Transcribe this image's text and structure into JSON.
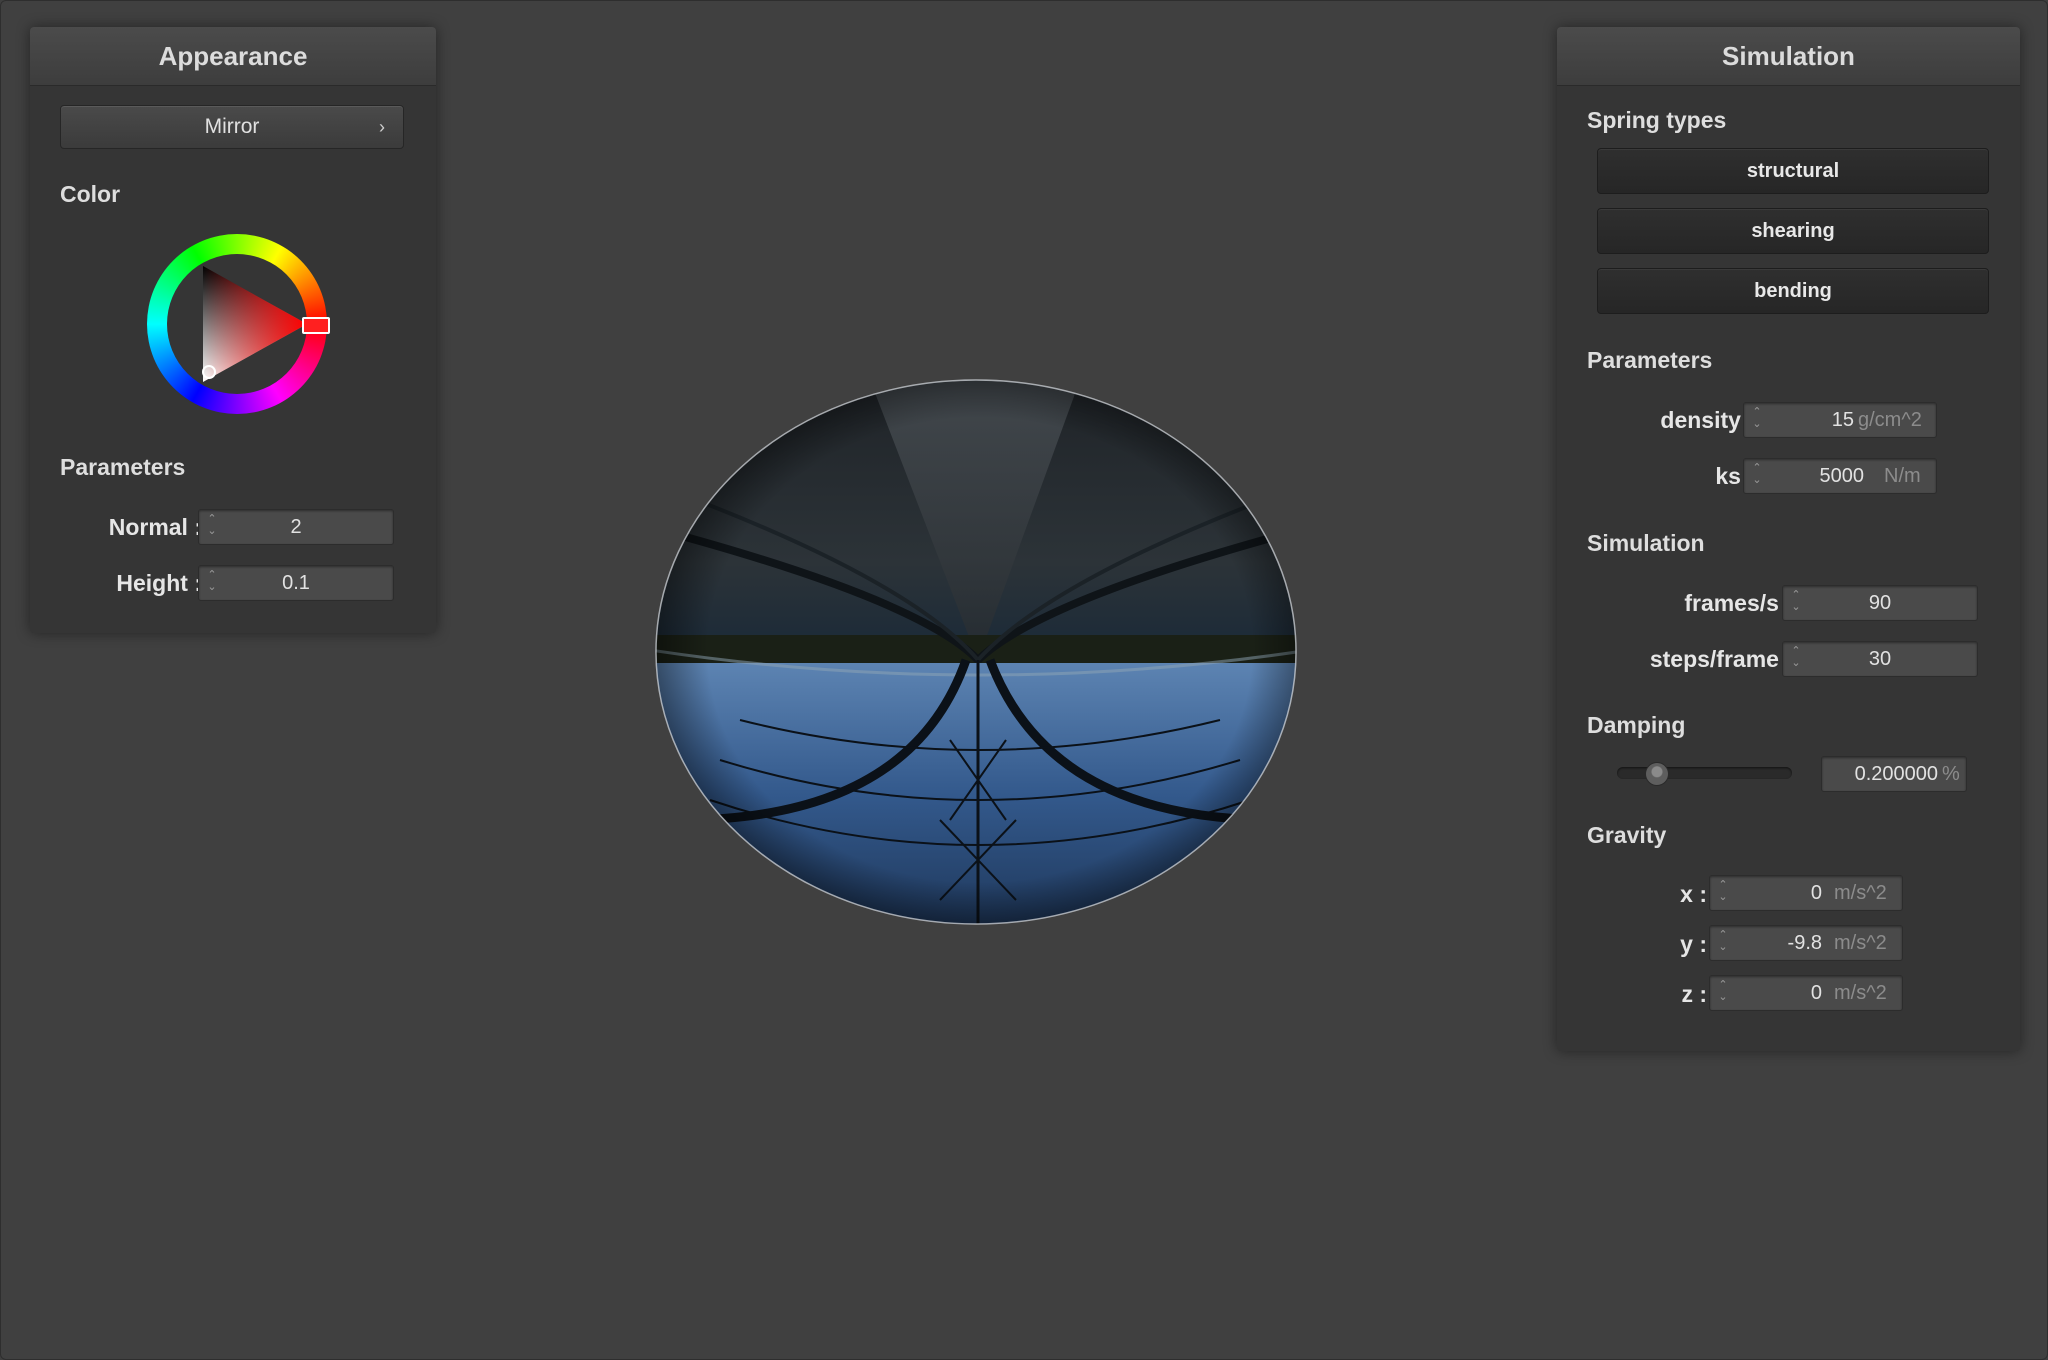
{
  "appearance": {
    "title": "Appearance",
    "shader_button": "Mirror",
    "chevron": "›",
    "color_label": "Color",
    "color": "#ff0000",
    "params_label": "Parameters",
    "normal_label": "Normal :",
    "normal_value": "2",
    "height_label": "Height :",
    "height_value": "0.1"
  },
  "simulation": {
    "title": "Simulation",
    "spring_types_label": "Spring types",
    "spring_buttons": [
      "structural",
      "shearing",
      "bending"
    ],
    "parameters_label": "Parameters",
    "density_label": "density :",
    "density_value": "15",
    "density_unit": "g/cm^2",
    "ks_label": "ks :",
    "ks_value": "5000",
    "ks_unit": "N/m",
    "simulation_label": "Simulation",
    "fps_label": "frames/s :",
    "fps_value": "90",
    "steps_label": "steps/frame :",
    "steps_value": "30",
    "damping_label": "Damping",
    "damping_value": "0.200000",
    "damping_unit": "%",
    "damping_level": 0.2,
    "gravity_label": "Gravity",
    "gx_label": "x :",
    "gx_value": "0",
    "gy_label": "y :",
    "gy_value": "-9.8",
    "gz_label": "z :",
    "gz_value": "0",
    "g_unit": "m/s^2"
  },
  "scene": {
    "object": "mirror-sphere"
  }
}
